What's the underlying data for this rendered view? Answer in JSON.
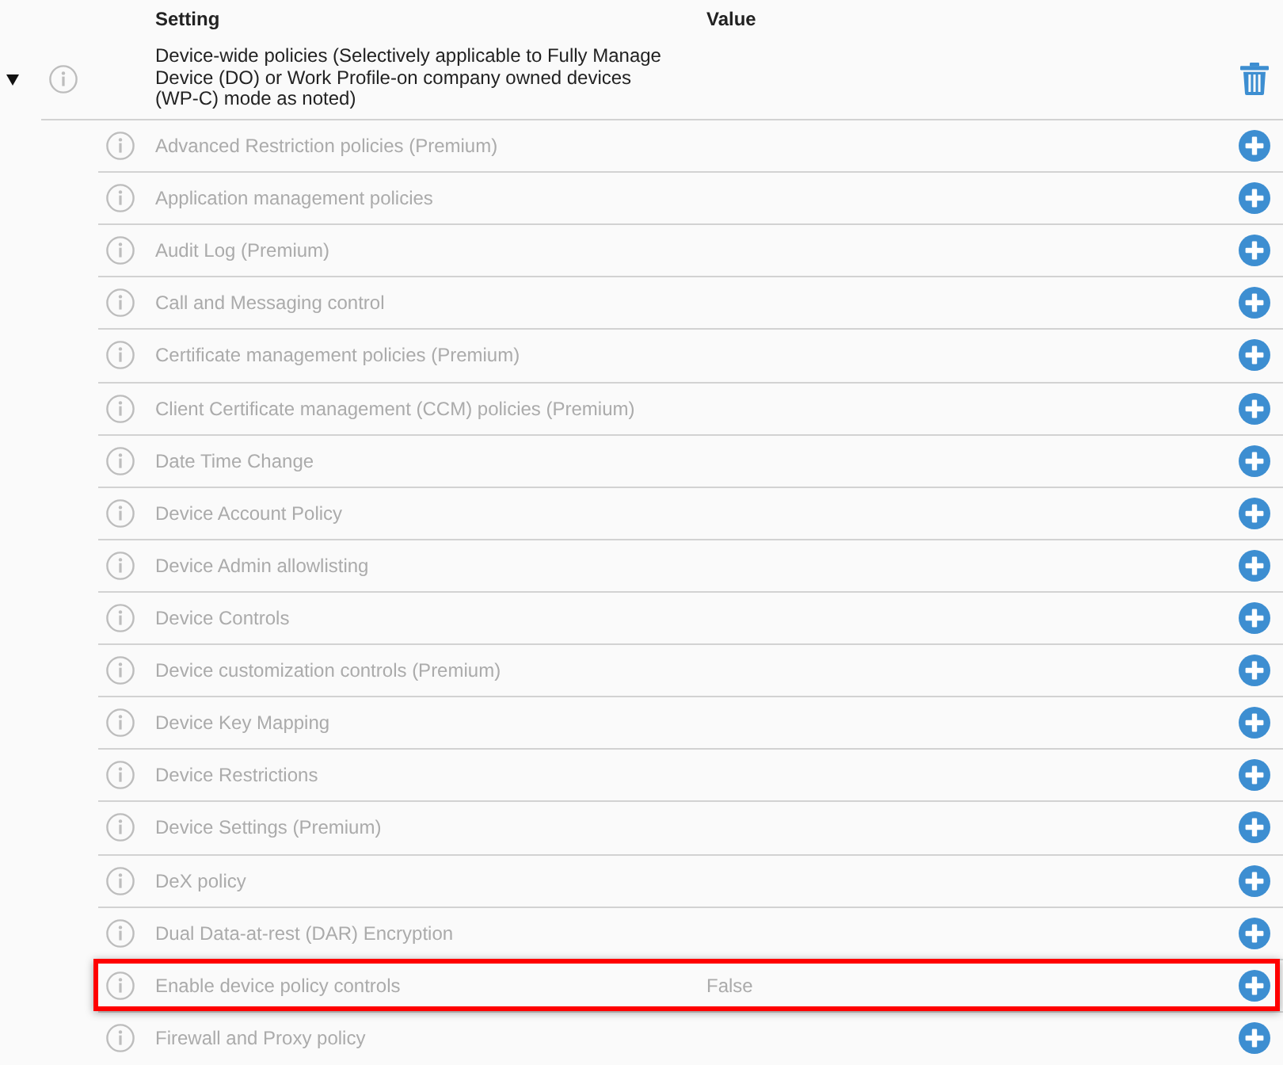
{
  "table": {
    "columns": [
      "Setting",
      "Value"
    ],
    "group": {
      "label": "Device-wide policies (Selectively applicable to Fully Manage Device (DO) or Work Profile-on company owned devices (WP-C) mode as noted)",
      "expanded": true,
      "children": [
        {
          "label": "Advanced Restriction policies (Premium)",
          "highlighted": false
        },
        {
          "label": "Application management policies",
          "highlighted": false
        },
        {
          "label": "Audit Log (Premium)",
          "highlighted": false
        },
        {
          "label": "Call and Messaging control",
          "highlighted": false
        },
        {
          "label": "Certificate management policies (Premium)",
          "highlighted": false
        },
        {
          "label": "Client Certificate management (CCM) policies (Premium)",
          "highlighted": false
        },
        {
          "label": "Date Time Change",
          "highlighted": false
        },
        {
          "label": "Device Account Policy",
          "highlighted": false
        },
        {
          "label": "Device Admin allowlisting",
          "highlighted": false
        },
        {
          "label": "Device Controls",
          "highlighted": false
        },
        {
          "label": "Device customization controls (Premium)",
          "highlighted": false
        },
        {
          "label": "Device Key Mapping",
          "highlighted": false
        },
        {
          "label": "Device Restrictions",
          "highlighted": false
        },
        {
          "label": "Device Settings (Premium)",
          "highlighted": false
        },
        {
          "label": "DeX policy",
          "highlighted": false
        },
        {
          "label": "Dual Data-at-rest (DAR) Encryption",
          "highlighted": false
        },
        {
          "label": "Enable device policy controls",
          "value": "False",
          "highlighted": true
        },
        {
          "label": "Firewall and Proxy policy",
          "highlighted": false
        }
      ]
    }
  }
}
